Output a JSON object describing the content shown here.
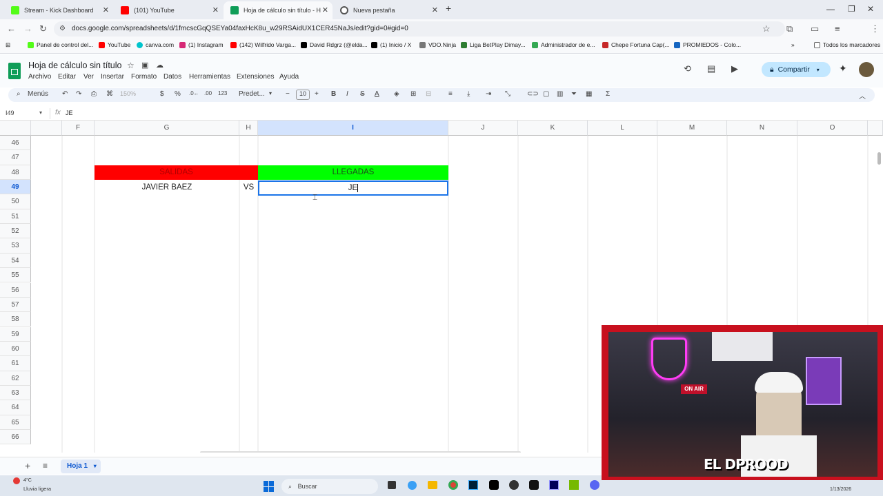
{
  "tabs": [
    {
      "label": "Stream - Kick Dashboard",
      "color": "#53fc18"
    },
    {
      "label": "(101) YouTube",
      "color": "#ff0000"
    },
    {
      "label": "Hoja de cálculo sin título - Hoja",
      "color": "#0f9d58"
    },
    {
      "label": "Nueva pestaña",
      "color": "#555555"
    }
  ],
  "address": {
    "url": "docs.google.com/spreadsheets/d/1fmcscGqQSEYa04faxHcK8u_w29RSAidUX1CER45NaJs/edit?gid=0#gid=0"
  },
  "bookmarks": [
    "Panel de control del...",
    "YouTube",
    "canva.com",
    "(1) Instagram",
    "(142) Wilfrido Varga...",
    "David Rdgrz (@elda...",
    "(1) Inicio / X",
    "VDO.Ninja",
    "Liga BetPlay Dimay...",
    "Administrador de e...",
    "Chepe Fortuna Cap(...",
    "PROMIEDOS - Colo...",
    "Todos los marcadores"
  ],
  "sheets": {
    "title": "Hoja de cálculo sin título",
    "menus": [
      "Archivo",
      "Editar",
      "Ver",
      "Insertar",
      "Formato",
      "Datos",
      "Herramientas",
      "Extensiones",
      "Ayuda"
    ],
    "share_label": "Compartir",
    "toolbar": {
      "search": "Menús",
      "zoom": "150%",
      "currency": "$",
      "percent": "%",
      "dec_less": ".0←",
      "dec_more": ".00",
      "num123": "123",
      "font": "Predet...",
      "font_size": "10"
    },
    "name_box": "I49",
    "formula": "JE"
  },
  "grid": {
    "columns": [
      "F",
      "G",
      "H",
      "I",
      "J",
      "K",
      "L",
      "M",
      "N",
      "O"
    ],
    "rows": [
      "46",
      "47",
      "48",
      "49",
      "50",
      "51",
      "52",
      "53",
      "54",
      "55",
      "56",
      "57",
      "58",
      "59",
      "60",
      "61",
      "62",
      "63",
      "64",
      "65",
      "66"
    ],
    "selected_column": "I",
    "selected_row": "49",
    "cells": {
      "salidas": "SALIDAS",
      "llegadas": "LLEGADAS",
      "player": "JAVIER BAEZ",
      "vs": "VS",
      "editing": "JE"
    },
    "colors": {
      "salidas_bg": "#ff0000",
      "llegadas_bg": "#00ff00",
      "selection": "#1a73e8"
    }
  },
  "sheet_tab": {
    "label": "Hoja 1"
  },
  "taskbar": {
    "weather_temp": "4°C",
    "weather_text": "Lluvia ligera",
    "search": "Buscar",
    "date": "1/13/2026"
  },
  "overlay": {
    "streamer_logo": "EL DPROOD",
    "sign": "ON AIR"
  }
}
